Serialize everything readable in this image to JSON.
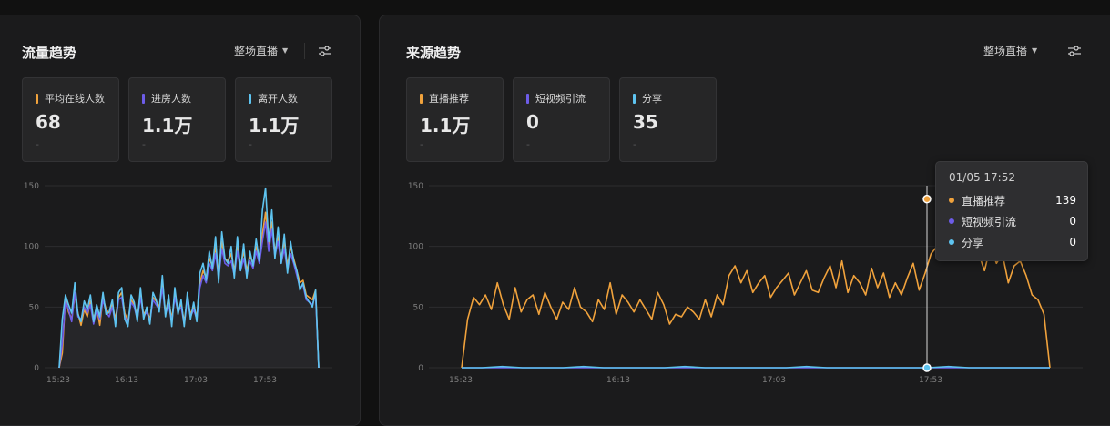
{
  "left_panel": {
    "title": "流量趋势",
    "dropdown": "整场直播",
    "cards": [
      {
        "label": "平均在线人数",
        "value": "68",
        "sub": "-",
        "color": "#f0a23c"
      },
      {
        "label": "进房人数",
        "value": "1.1万",
        "sub": "-",
        "color": "#6d5ce8"
      },
      {
        "label": "离开人数",
        "value": "1.1万",
        "sub": "-",
        "color": "#5ec4f0"
      }
    ],
    "chart_data": {
      "type": "line",
      "y_ticks": [
        "150",
        "100",
        "50",
        "0"
      ],
      "ylim": [
        0,
        150
      ],
      "x_ticks": [
        "15:23",
        "16:13",
        "17:03",
        "17:53"
      ],
      "series": [
        {
          "name": "平均在线人数",
          "color": "#f0a23c",
          "values": [
            0,
            12,
            58,
            46,
            40,
            60,
            45,
            35,
            48,
            42,
            55,
            40,
            50,
            35,
            58,
            48,
            45,
            52,
            40,
            58,
            62,
            45,
            38,
            56,
            52,
            42,
            60,
            44,
            48,
            40,
            58,
            55,
            50,
            70,
            46,
            56,
            40,
            60,
            48,
            52,
            38,
            58,
            44,
            50,
            42,
            70,
            80,
            74,
            90,
            84,
            100,
            78,
            104,
            90,
            88,
            94,
            80,
            100,
            84,
            96,
            80,
            92,
            86,
            100,
            90,
            110,
            128,
            100,
            120,
            96,
            108,
            90,
            104,
            84,
            100,
            90,
            80,
            70,
            72,
            60,
            58,
            56,
            64,
            0
          ]
        },
        {
          "name": "进房人数",
          "color": "#6d5ce8",
          "values": [
            0,
            20,
            55,
            48,
            38,
            62,
            42,
            40,
            50,
            45,
            52,
            36,
            48,
            40,
            56,
            46,
            42,
            50,
            36,
            56,
            58,
            42,
            36,
            54,
            50,
            40,
            58,
            42,
            46,
            38,
            56,
            52,
            48,
            66,
            44,
            52,
            38,
            58,
            46,
            50,
            36,
            56,
            42,
            48,
            40,
            66,
            76,
            70,
            86,
            80,
            94,
            74,
            98,
            86,
            84,
            88,
            76,
            96,
            80,
            90,
            76,
            88,
            82,
            96,
            86,
            104,
            120,
            96,
            114,
            92,
            104,
            86,
            98,
            80,
            94,
            86,
            76,
            66,
            68,
            56,
            54,
            52,
            60,
            0
          ]
        },
        {
          "name": "离开人数",
          "color": "#5ec4f0",
          "values": [
            0,
            40,
            60,
            52,
            45,
            70,
            44,
            38,
            55,
            48,
            60,
            38,
            52,
            42,
            62,
            44,
            46,
            56,
            34,
            62,
            66,
            40,
            34,
            60,
            54,
            38,
            66,
            40,
            50,
            36,
            62,
            56,
            46,
            76,
            42,
            60,
            34,
            66,
            44,
            56,
            34,
            62,
            40,
            54,
            38,
            78,
            86,
            72,
            96,
            82,
            108,
            70,
            112,
            90,
            86,
            100,
            74,
            108,
            80,
            102,
            74,
            96,
            84,
            106,
            88,
            130,
            148,
            104,
            130,
            90,
            116,
            86,
            110,
            78,
            104,
            88,
            80,
            64,
            70,
            58,
            54,
            50,
            64,
            0
          ]
        }
      ]
    }
  },
  "right_panel": {
    "title": "来源趋势",
    "dropdown": "整场直播",
    "cards": [
      {
        "label": "直播推荐",
        "value": "1.1万",
        "sub": "-",
        "color": "#f0a23c"
      },
      {
        "label": "短视频引流",
        "value": "0",
        "sub": "-",
        "color": "#6d5ce8"
      },
      {
        "label": "分享",
        "value": "35",
        "sub": "-",
        "color": "#5ec4f0"
      }
    ],
    "chart_data": {
      "type": "line",
      "y_ticks": [
        "150",
        "100",
        "50",
        "0"
      ],
      "ylim": [
        0,
        150
      ],
      "x_ticks": [
        "15:23",
        "16:13",
        "17:03",
        "17:53"
      ],
      "series": [
        {
          "name": "直播推荐",
          "color": "#f0a23c",
          "values": [
            0,
            40,
            58,
            52,
            60,
            48,
            70,
            52,
            40,
            66,
            46,
            56,
            60,
            44,
            62,
            50,
            40,
            54,
            48,
            66,
            50,
            46,
            38,
            56,
            48,
            70,
            44,
            60,
            54,
            46,
            56,
            48,
            40,
            62,
            52,
            36,
            44,
            42,
            50,
            46,
            40,
            56,
            42,
            60,
            52,
            76,
            84,
            70,
            80,
            62,
            70,
            76,
            58,
            66,
            72,
            78,
            60,
            70,
            80,
            64,
            62,
            74,
            84,
            66,
            88,
            62,
            76,
            70,
            60,
            82,
            66,
            78,
            58,
            70,
            60,
            74,
            86,
            64,
            78,
            94,
            100,
            120,
            139,
            100,
            114,
            90,
            110,
            94,
            80,
            100,
            86,
            94,
            70,
            84,
            88,
            76,
            60,
            56,
            44,
            0
          ]
        },
        {
          "name": "短视频引流",
          "color": "#6d5ce8",
          "values": [
            0,
            0,
            0,
            0,
            0,
            0,
            0,
            0,
            0,
            0,
            0,
            0,
            0,
            0,
            0,
            0,
            0,
            0,
            0,
            0,
            0,
            0,
            0,
            0,
            0,
            0,
            0,
            0,
            0,
            0
          ]
        },
        {
          "name": "分享",
          "color": "#5ec4f0",
          "values": [
            0,
            0,
            1,
            0,
            0,
            0,
            1,
            0,
            0,
            0,
            0,
            1,
            0,
            0,
            0,
            0,
            0,
            1,
            0,
            0,
            0,
            0,
            0,
            0,
            1,
            0,
            0,
            0,
            0,
            0
          ]
        }
      ]
    },
    "tooltip": {
      "time": "01/05 17:52",
      "rows": [
        {
          "label": "直播推荐",
          "value": "139",
          "color": "#f0a23c"
        },
        {
          "label": "短视频引流",
          "value": "0",
          "color": "#6d5ce8"
        },
        {
          "label": "分享",
          "value": "0",
          "color": "#5ec4f0"
        }
      ]
    }
  }
}
